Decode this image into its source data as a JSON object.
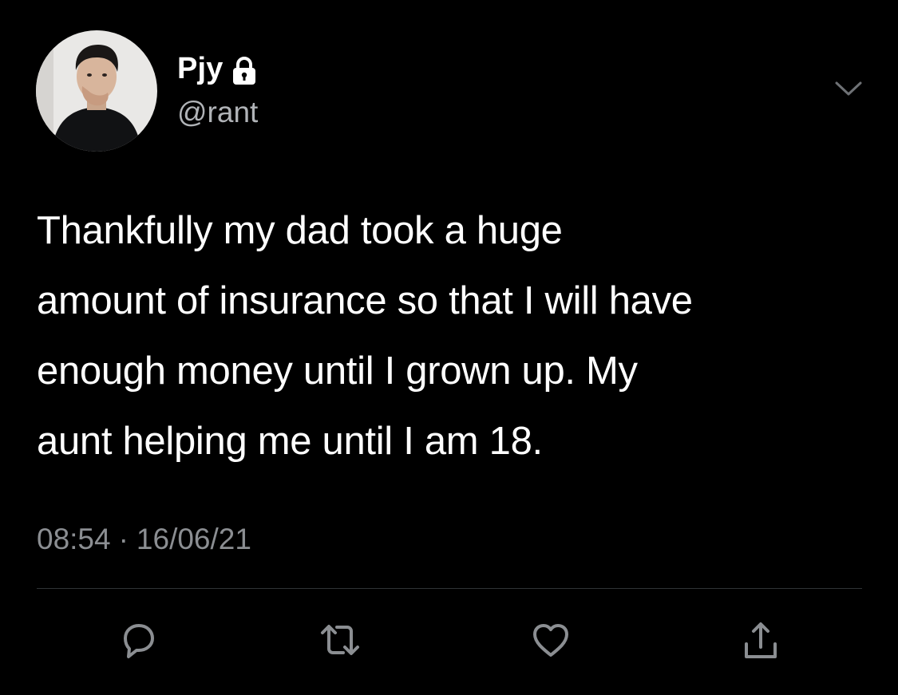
{
  "user": {
    "display_name": "Pjy",
    "handle": "@rant",
    "avatar_icon": "profile-photo",
    "lock_icon": "lock-icon"
  },
  "tweet": {
    "text": "Thankfully my dad took a huge\namount of insurance so that I will have\nenough money until I grown up. My\naunt helping me until I am 18.",
    "time": "08:54",
    "separator": "·",
    "date": "16/06/21"
  },
  "menu": {
    "icon": "chevron-down-icon"
  },
  "actions": {
    "reply_icon": "reply-icon",
    "retweet_icon": "retweet-icon",
    "like_icon": "heart-icon",
    "share_icon": "share-icon"
  },
  "colors": {
    "background": "#000000",
    "text_primary": "#ffffff",
    "text_secondary": "#8b8e92",
    "icon": "#8b8e92",
    "divider": "#2f3336"
  }
}
